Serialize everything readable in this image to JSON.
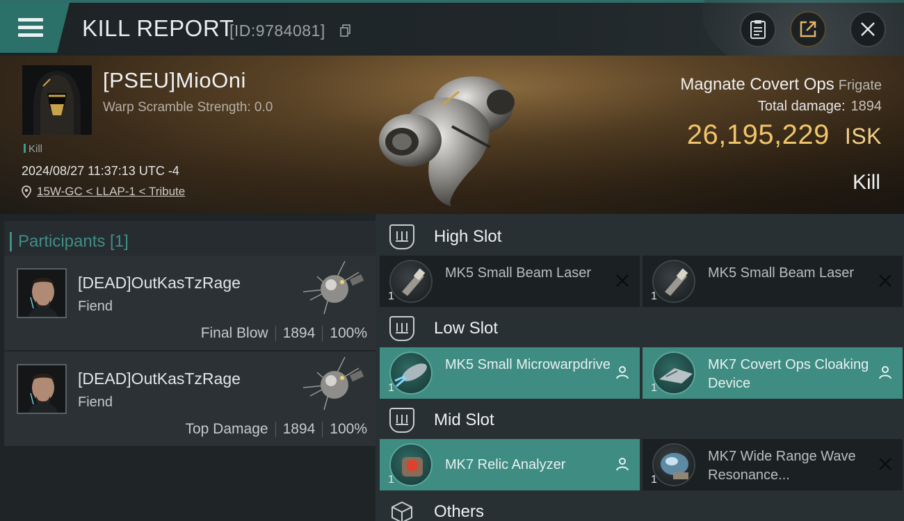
{
  "header": {
    "title": "KILL REPORT",
    "id_text": "[ID:9784081]"
  },
  "victim": {
    "name": "[PSEU]MioOni",
    "warp_scramble": "Warp Scramble Strength: 0.0",
    "tag": "Kill",
    "datetime": "2024/08/27 11:37:13 UTC -4",
    "location": "15W-GC < LLAP-1 < Tribute",
    "ship_name": "Magnate Covert Ops",
    "ship_class": "Frigate",
    "total_damage_label": "Total damage:",
    "total_damage": "1894",
    "isk_value": "26,195,229",
    "isk_unit": "ISK",
    "result": "Kill"
  },
  "participants": {
    "label": "Participants [1]",
    "list": [
      {
        "name": "[DEAD]OutKasTzRage",
        "corp": "Fiend",
        "role": "Final Blow",
        "damage": "1894",
        "percent": "100%"
      },
      {
        "name": "[DEAD]OutKasTzRage",
        "corp": "Fiend",
        "role": "Top Damage",
        "damage": "1894",
        "percent": "100%"
      }
    ]
  },
  "fittings": {
    "high_slot_label": "High Slot",
    "low_slot_label": "Low Slot",
    "mid_slot_label": "Mid Slot",
    "others_label": "Others",
    "high": [
      {
        "name": "MK5 Small Beam Laser",
        "qty": "1",
        "status": "destroyed"
      },
      {
        "name": "MK5 Small Beam Laser",
        "qty": "1",
        "status": "destroyed"
      }
    ],
    "low": [
      {
        "name": "MK5 Small Microwarpdrive",
        "qty": "1",
        "status": "dropped"
      },
      {
        "name": "MK7 Covert Ops Cloaking Device",
        "qty": "1",
        "status": "dropped"
      }
    ],
    "mid": [
      {
        "name": "MK7 Relic Analyzer",
        "qty": "1",
        "status": "dropped"
      },
      {
        "name": "MK7 Wide Range Wave Resonance...",
        "qty": "1",
        "status": "destroyed"
      }
    ]
  },
  "colors": {
    "accent_teal": "#3f8c83",
    "isk_gold": "#f0c46a",
    "background": "#1e2326"
  }
}
